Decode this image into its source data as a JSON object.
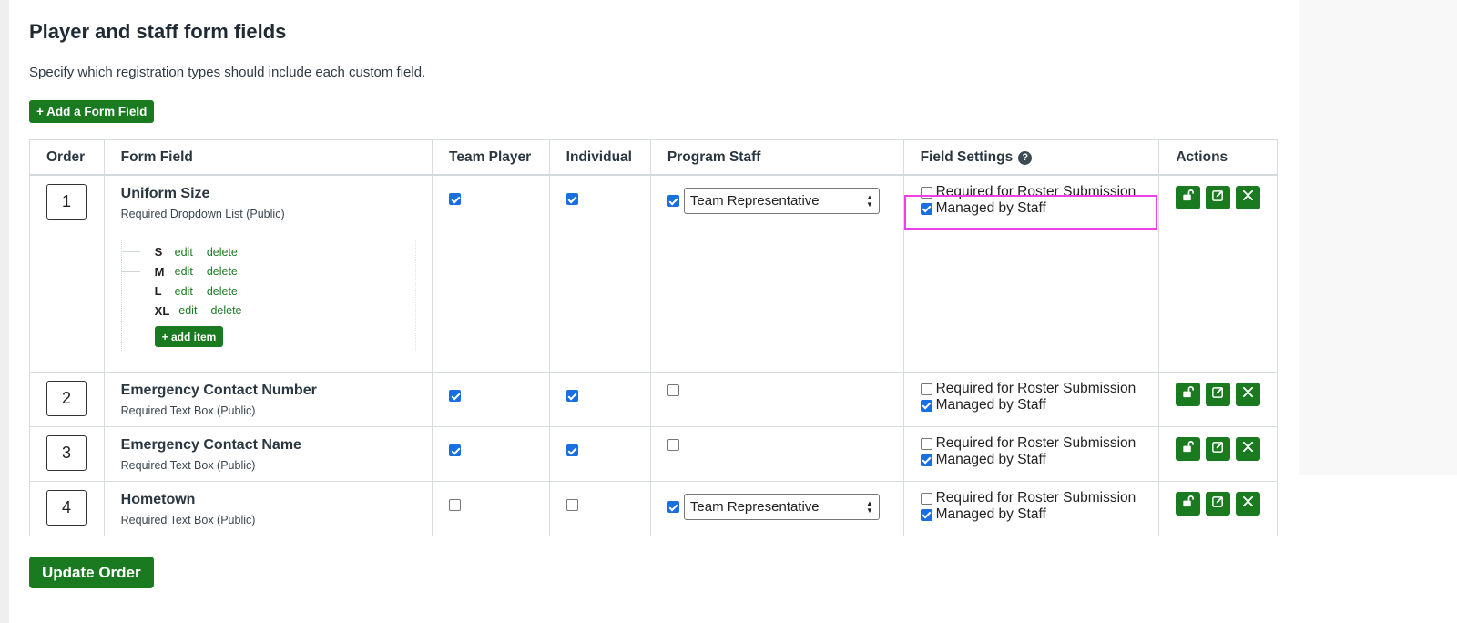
{
  "section": {
    "title": "Player and staff form fields",
    "description": "Specify which registration types should include each custom field.",
    "add_field_label": "+ Add a Form Field",
    "update_order_label": "Update Order"
  },
  "table": {
    "headers": {
      "order": "Order",
      "form_field": "Form Field",
      "team_player": "Team Player",
      "individual": "Individual",
      "program_staff": "Program Staff",
      "field_settings": "Field Settings",
      "actions": "Actions"
    },
    "help_icon_glyph": "?",
    "setting_labels": {
      "required": "Required for Roster Submission",
      "managed": "Managed by Staff"
    },
    "rows": [
      {
        "order": "1",
        "name": "Uniform Size",
        "type": "Required Dropdown List (Public)",
        "team_player": true,
        "individual": true,
        "program_staff": true,
        "staff_role": "Team Representative",
        "required_roster": false,
        "managed_by_staff": true,
        "options": [
          {
            "label": "S",
            "edit": "edit",
            "delete": "delete"
          },
          {
            "label": "M",
            "edit": "edit",
            "delete": "delete"
          },
          {
            "label": "L",
            "edit": "edit",
            "delete": "delete"
          },
          {
            "label": "XL",
            "edit": "edit",
            "delete": "delete"
          }
        ],
        "add_item_label": "+ add item"
      },
      {
        "order": "2",
        "name": "Emergency Contact Number",
        "type": "Required Text Box (Public)",
        "team_player": true,
        "individual": true,
        "program_staff": false,
        "required_roster": false,
        "managed_by_staff": true
      },
      {
        "order": "3",
        "name": "Emergency Contact Name",
        "type": "Required Text Box (Public)",
        "team_player": true,
        "individual": true,
        "program_staff": false,
        "required_roster": false,
        "managed_by_staff": true
      },
      {
        "order": "4",
        "name": "Hometown",
        "type": "Required Text Box (Public)",
        "team_player": false,
        "individual": false,
        "program_staff": true,
        "staff_role": "Team Representative",
        "required_roster": false,
        "managed_by_staff": true
      }
    ]
  },
  "icons": {
    "unlock": "unlock-icon",
    "edit": "edit-icon",
    "delete": "close-icon"
  },
  "colors": {
    "brand_green": "#1a7a1f",
    "link_green": "#1d7a22",
    "checkbox_blue": "#1a6fe0",
    "highlight_magenta": "#ee3fe8"
  }
}
